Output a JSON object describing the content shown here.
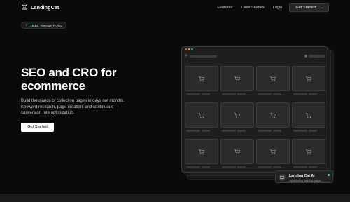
{
  "colors": {
    "background": "#0a0a0a",
    "accent_green": "#4ade80",
    "window_dot_red": "#ef4444",
    "window_dot_yellow": "#eab308",
    "window_dot_green": "#22c55e",
    "toast_dot": "#4ade80"
  },
  "header": {
    "brand_icon": "cat-logo-icon",
    "brand_name": "LandingCat",
    "nav": [
      "Features",
      "Case Studies",
      "Login"
    ],
    "cta_label": "Get Started",
    "cta_icon": "arrow-right-icon"
  },
  "badge": {
    "icon": "check-icon",
    "value": "15.6x",
    "label": "Average ROAS"
  },
  "hero": {
    "title": "SEO and CRO for ecommerce",
    "subtitle": "Build thousands of collection pages in days not months. Keyword research, page creation, and continuous conversion rate optimization.",
    "cta_label": "Get Started"
  },
  "preview": {
    "search_icon": "search-icon",
    "product_icon": "shopping-cart-icon",
    "product_count": 12
  },
  "toast": {
    "icon": "cat-logo-icon",
    "title": "Landing Cat AI",
    "status": "Optimizing landing page..."
  }
}
